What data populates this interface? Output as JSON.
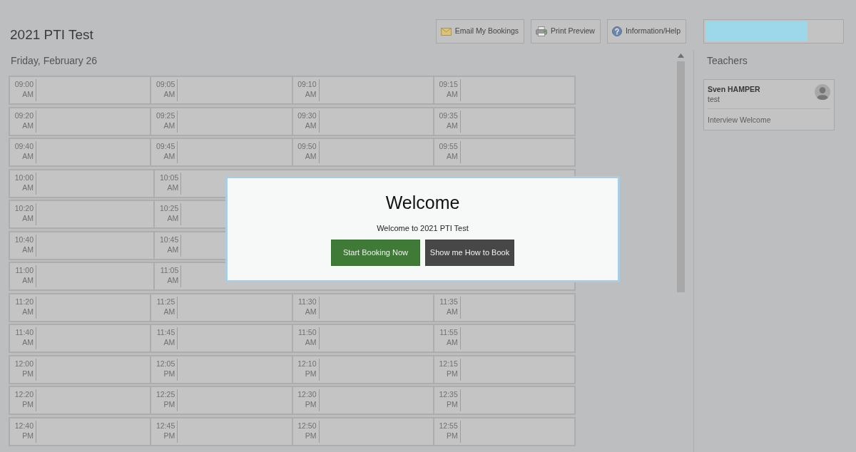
{
  "page": {
    "title": "2021 PTI Test"
  },
  "toolbar": {
    "buttons": [
      {
        "kind": "email",
        "label": "Email My Bookings"
      },
      {
        "kind": "print",
        "label": "Print Preview"
      },
      {
        "kind": "help",
        "label": "Information/Help"
      }
    ],
    "progress": {
      "level": 0.75
    }
  },
  "schedule": {
    "date": "Friday, February 26",
    "rows": [
      {
        "slots": [
          {
            "time": "09:00",
            "period": "AM"
          },
          {
            "time": "09:05",
            "period": "AM"
          },
          {
            "time": "09:10",
            "period": "AM"
          },
          {
            "time": "09:15",
            "period": "AM"
          }
        ]
      },
      {
        "slots": [
          {
            "time": "09:20",
            "period": "AM"
          },
          {
            "time": "09:25",
            "period": "AM"
          },
          {
            "time": "09:30",
            "period": "AM"
          },
          {
            "time": "09:35",
            "period": "AM"
          }
        ]
      },
      {
        "slots": [
          {
            "time": "09:40",
            "period": "AM"
          },
          {
            "time": "09:45",
            "period": "AM"
          },
          {
            "time": "09:50",
            "period": "AM"
          },
          {
            "time": "09:55",
            "period": "AM"
          }
        ]
      },
      {
        "slots": [
          {
            "time": "10:00",
            "period": "AM"
          },
          {
            "time": "10:05",
            "period": "AM"
          }
        ]
      },
      {
        "slots": [
          {
            "time": "10:20",
            "period": "AM"
          },
          {
            "time": "10:25",
            "period": "AM"
          }
        ]
      },
      {
        "slots": [
          {
            "time": "10:40",
            "period": "AM"
          },
          {
            "time": "10:45",
            "period": "AM"
          }
        ]
      },
      {
        "slots": [
          {
            "time": "11:00",
            "period": "AM"
          },
          {
            "time": "11:05",
            "period": "AM"
          }
        ]
      },
      {
        "slots": [
          {
            "time": "11:20",
            "period": "AM"
          },
          {
            "time": "11:25",
            "period": "AM"
          },
          {
            "time": "11:30",
            "period": "AM"
          },
          {
            "time": "11:35",
            "period": "AM"
          }
        ]
      },
      {
        "slots": [
          {
            "time": "11:40",
            "period": "AM"
          },
          {
            "time": "11:45",
            "period": "AM"
          },
          {
            "time": "11:50",
            "period": "AM"
          },
          {
            "time": "11:55",
            "period": "AM"
          }
        ]
      },
      {
        "slots": [
          {
            "time": "12:00",
            "period": "PM"
          },
          {
            "time": "12:05",
            "period": "PM"
          },
          {
            "time": "12:10",
            "period": "PM"
          },
          {
            "time": "12:15",
            "period": "PM"
          }
        ]
      },
      {
        "slots": [
          {
            "time": "12:20",
            "period": "PM"
          },
          {
            "time": "12:25",
            "period": "PM"
          },
          {
            "time": "12:30",
            "period": "PM"
          },
          {
            "time": "12:35",
            "period": "PM"
          }
        ]
      },
      {
        "slots": [
          {
            "time": "12:40",
            "period": "PM"
          },
          {
            "time": "12:45",
            "period": "PM"
          },
          {
            "time": "12:50",
            "period": "PM"
          },
          {
            "time": "12:55",
            "period": "PM"
          }
        ]
      }
    ]
  },
  "sidebar": {
    "heading": "Teachers",
    "teachers": [
      {
        "name": "Sven HAMPER",
        "subject": "test",
        "note": "Interview Welcome"
      }
    ]
  },
  "modal": {
    "title": "Welcome",
    "message": "Welcome to 2021 PTI Test",
    "buttons": [
      {
        "kind": "primary",
        "label": "Start Booking Now"
      },
      {
        "kind": "secondary",
        "label": "Show me How to Book"
      }
    ]
  }
}
